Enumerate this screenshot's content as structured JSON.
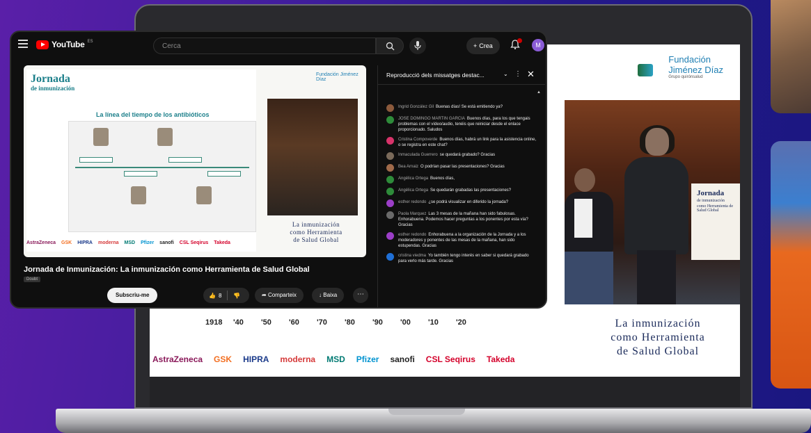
{
  "youtube": {
    "brand": "YouTube",
    "country_code": "ES",
    "search_placeholder": "Cerca",
    "create_label": "Crea",
    "avatar_letter": "M",
    "video_title": "Jornada de Inmunización: La inmunización como Herramienta de Salud Global",
    "badge": "Doubt",
    "subscribe_label": "Subscriu-me",
    "like_count": "8",
    "share_label": "Comparteix",
    "download_label": "Baixa",
    "chat_header": "Reproducció dels missatges destac...",
    "messages": [
      {
        "user": "Ingrid González Gil",
        "text": "Buenas días! Se está emitiendo ya?",
        "color": "#8c5a3c"
      },
      {
        "user": "JOSE DOMINGO MARTIN GARCIA",
        "text": "Buenos días, para los que tengais problemas con el vídeo/audio, tenéis que reiniciar desde el enlace proporcionado. Saludos",
        "color": "#2e8b3a"
      },
      {
        "user": "Cristina Compoverde",
        "text": "Buenos días, habrá un link para la asistencia online, o se registra en este chat?",
        "color": "#d8336a"
      },
      {
        "user": "Inmaculada Guerrero",
        "text": "se quedará grabado? Gracias",
        "color": "#7a6a5a"
      },
      {
        "user": "Bea Arnaiz",
        "text": "O podrían pasar las presentaciones? Gracias",
        "color": "#a06a4a"
      },
      {
        "user": "Angélica Ortega",
        "text": "Buenos días,",
        "color": "#2e8b3a"
      },
      {
        "user": "Angélica Ortega",
        "text": "Se quedarán grabadas las presentaciones?",
        "color": "#2e8b3a"
      },
      {
        "user": "esther redondo",
        "text": "¿se podrá visualizar en diferido la jornada?",
        "color": "#9b3ec7"
      },
      {
        "user": "Paola Marquez",
        "text": "Las 3 mesas de la mañana han sido fabulosas. Enhorabuena. Podemos hacer preguntas a los ponentes por esta vía? Gracias",
        "color": "#6a6a6a"
      },
      {
        "user": "esther redondo",
        "text": "Enhorabuena a la organización de la Jornada y a los moderadores y ponentes de las mesas de la mañana, han sido estupendas. Gracias",
        "color": "#9b3ec7"
      },
      {
        "user": "cristina viedma",
        "text": "Yo también tengo interés en saber si quedará grabado para verlo más tarde. Gracias",
        "color": "#1f6fd6"
      }
    ],
    "slide": {
      "jornada_line1": "Jornada",
      "jornada_line2": "de inmunización",
      "heading": "La línea del tiempo de los antibióticos",
      "fund_name": "Fundación Jiménez Díaz",
      "title_lines": [
        "La inmunización",
        "como Herramienta",
        "de Salud Global"
      ],
      "sponsors": [
        "AstraZeneca",
        "GSK",
        "HIPRA",
        "moderna",
        "MSD",
        "Pfizer",
        "sanofi",
        "CSL Seqirus",
        "Takeda"
      ]
    }
  },
  "laptop_screen": {
    "fund_line1": "Fundación",
    "fund_line2": "Jiménez Díaz",
    "fund_line3": "Grupo quirónsalud",
    "banner_line1": "Jornada",
    "banner_line2": "de inmunización",
    "banner_line3": "como Herramienta de Salud Global",
    "title_lines": [
      "La inmunización",
      "como Herramienta",
      "de Salud Global"
    ],
    "years": [
      "1918",
      "'40",
      "'50",
      "'60",
      "'70",
      "'80",
      "'90",
      "'00",
      "'10",
      "'20"
    ],
    "sponsors": [
      {
        "name": "AstraZeneca",
        "color": "#8a1a5a"
      },
      {
        "name": "GSK",
        "color": "#f36f21"
      },
      {
        "name": "HIPRA",
        "color": "#1a3a8a"
      },
      {
        "name": "moderna",
        "color": "#d63a3a"
      },
      {
        "name": "MSD",
        "color": "#007a73"
      },
      {
        "name": "Pfizer",
        "color": "#0093d0"
      },
      {
        "name": "sanofi",
        "color": "#222222"
      },
      {
        "name": "CSL Seqirus",
        "color": "#d4002a"
      },
      {
        "name": "Takeda",
        "color": "#d4002a"
      }
    ]
  }
}
